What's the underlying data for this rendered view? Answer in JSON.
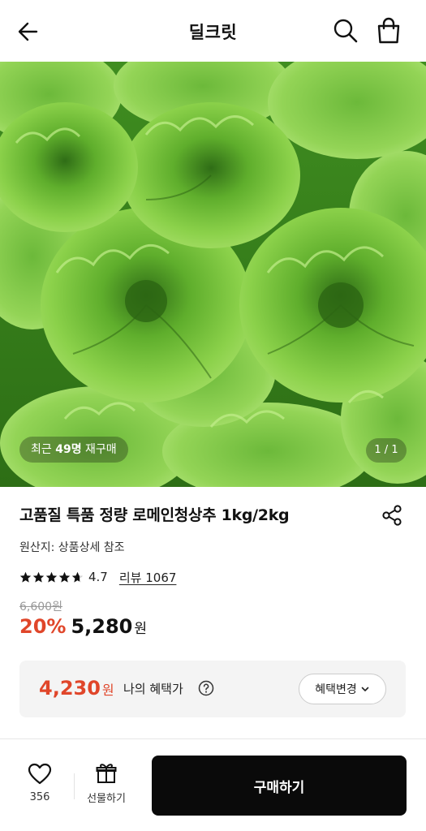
{
  "header": {
    "title": "딜크릿",
    "icons": {
      "back": "arrow-left-icon",
      "search": "search-icon",
      "cart": "shopping-bag-icon"
    }
  },
  "hero": {
    "rebuy_prefix": "최근 ",
    "rebuy_count": "49명",
    "rebuy_suffix": " 재구매",
    "pager": "1 / 1"
  },
  "product": {
    "title": "고품질 특품 정량 로메인청상추 1kg/2kg",
    "origin": "원산지: 상품상세 참조",
    "rating": "4.7",
    "rating_value": 4.7,
    "review_label": "리뷰 1067",
    "original_price": "6,600원",
    "discount": "20%",
    "price": "5,280",
    "currency": "원"
  },
  "benefit": {
    "price": "4,230",
    "currency": "원",
    "label": "나의 혜택가",
    "change_label": "혜택변경"
  },
  "bottom": {
    "like_count": "356",
    "gift_label": "선물하기",
    "buy_label": "구매하기"
  },
  "colors": {
    "accent": "#e0462a",
    "buy_button": "#0a0a0a",
    "benefit_bg": "#f4f4f4",
    "lettuce_light": "#8bd14a",
    "lettuce_dark": "#2f7517"
  }
}
